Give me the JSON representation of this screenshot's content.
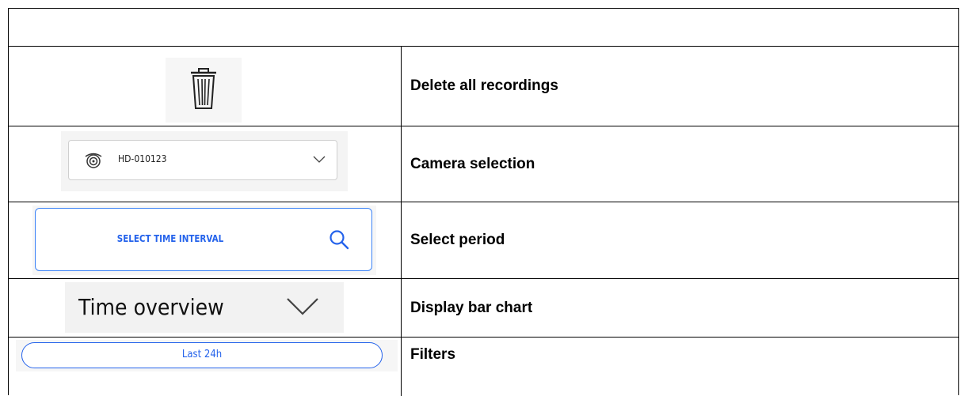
{
  "rows": [
    {
      "label": "Delete all recordings",
      "icon": "trash-icon"
    },
    {
      "label": "Camera selection",
      "camera_value": "HD-010123",
      "icon": "camera-icon"
    },
    {
      "label": "Select period",
      "button_label": "SELECT TIME INTERVAL",
      "icon": "search-icon"
    },
    {
      "label": "Display bar chart",
      "toggle_label": "Time overview",
      "icon": "chevron-down-icon"
    },
    {
      "label": "Filters",
      "filter_value": "Last 24h"
    }
  ],
  "colors": {
    "accent": "#2563eb",
    "border": "#000000"
  }
}
